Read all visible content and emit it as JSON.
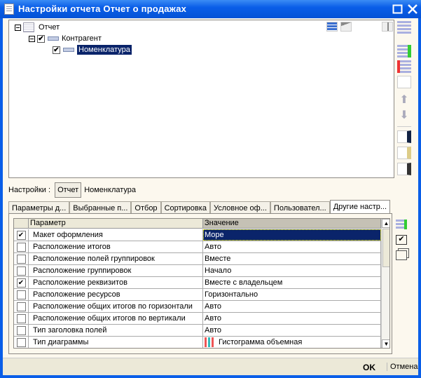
{
  "window": {
    "title": "Настройки отчета  Отчет о продажах"
  },
  "tree": {
    "nodes": [
      {
        "label": "Отчет",
        "checked": null
      },
      {
        "label": "Контрагент",
        "checked": true
      },
      {
        "label": "Номенклатура",
        "checked": true,
        "selected": true
      }
    ]
  },
  "settings": {
    "label": "Настройки :",
    "button": "Отчет",
    "value": "Номенклатура"
  },
  "tabs": [
    "Параметры д...",
    "Выбранные п...",
    "Отбор",
    "Сортировка",
    "Условное оф...",
    "Пользовател...",
    "Другие настр..."
  ],
  "active_tab": 6,
  "grid": {
    "headers": [
      "Параметр",
      "Значение"
    ],
    "rows": [
      {
        "checked": true,
        "param": "Макет оформления",
        "value": "Море"
      },
      {
        "checked": false,
        "param": "Расположение итогов",
        "value": "Авто"
      },
      {
        "checked": false,
        "param": "Расположение полей группировок",
        "value": "Вместе"
      },
      {
        "checked": false,
        "param": "Расположение группировок",
        "value": "Начало"
      },
      {
        "checked": true,
        "param": "Расположение реквизитов",
        "value": "Вместе с владельцем"
      },
      {
        "checked": false,
        "param": "Расположение ресурсов",
        "value": "Горизонтально"
      },
      {
        "checked": false,
        "param": "Расположение общих итогов по горизонтали",
        "value": "Авто"
      },
      {
        "checked": false,
        "param": "Расположение общих итогов по вертикали",
        "value": "Авто"
      },
      {
        "checked": false,
        "param": "Тип заголовка полей",
        "value": "Авто"
      },
      {
        "checked": false,
        "param": "Тип диаграммы",
        "value": "Гистограмма объемная",
        "icon": "bar-chart-icon"
      }
    ]
  },
  "footer": {
    "ok": "OK",
    "cancel": "Отмена"
  },
  "colors": {
    "titlebar": "#0a5ee8",
    "selection": "#0a246a",
    "background": "#fcf8ee"
  }
}
